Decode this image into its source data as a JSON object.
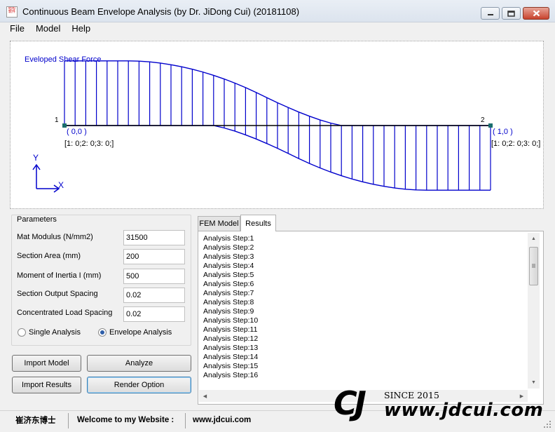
{
  "window": {
    "title": "Continuous Beam Envelope Analysis (by Dr. JiDong Cui) (20181108)",
    "icon_text": "结构 软件",
    "controls": {
      "minimize": "—",
      "maximize": "▭",
      "close": "✕"
    }
  },
  "menu": [
    {
      "label": "File"
    },
    {
      "label": "Model"
    },
    {
      "label": "Help"
    }
  ],
  "diagram": {
    "caption": "Eveloped Shear Force",
    "node1": {
      "id": "1",
      "coord": "( 0,0 )",
      "restraint": "[1: 0;2: 0;3: 0;]"
    },
    "node2": {
      "id": "2",
      "coord": "( 1,0 )",
      "restraint": "[1: 0;2: 0;3: 0;]"
    },
    "axis_y": "Y",
    "axis_x": "X",
    "line_color": "#0000cc",
    "node_color": "#1a6e6e",
    "upper_envelope": [
      95,
      95,
      95,
      95,
      95,
      95,
      95,
      94.7,
      93.6,
      91.8,
      89.4,
      86.4,
      82.8,
      78.6,
      73.8,
      68.4,
      62.4,
      55.8,
      48.6,
      41,
      33.5,
      26.5,
      19.8,
      13.7,
      8.2,
      3.6,
      0,
      0,
      0,
      0,
      0,
      0,
      0,
      0,
      0,
      0,
      0,
      0,
      0,
      0,
      0
    ],
    "lower_envelope": [
      0,
      0,
      0,
      0,
      0,
      0,
      0,
      0,
      0,
      0,
      0,
      0,
      0,
      0,
      0,
      -3.6,
      -8.2,
      -13.7,
      -19.8,
      -26.5,
      -33.5,
      -41,
      -48.6,
      -55.8,
      -62.4,
      -68.4,
      -73.8,
      -78.6,
      -82.8,
      -86.4,
      -89.4,
      -91.8,
      -93.6,
      -94.7,
      -95,
      -95,
      -95,
      -95,
      -95,
      -95,
      -95
    ]
  },
  "parameters": {
    "title": "Parameters",
    "fields": [
      {
        "label": "Mat Modulus (N/mm2)",
        "value": "31500"
      },
      {
        "label": "Section Area  (mm)",
        "value": "200"
      },
      {
        "label": "Moment of Inertia I (mm)",
        "value": "500"
      },
      {
        "label": "Section Output Spacing",
        "value": "0.02"
      },
      {
        "label": "Concentrated Load Spacing",
        "value": "0.02"
      }
    ],
    "radio_single": "Single Analysis",
    "radio_envelope": "Envelope Analysis",
    "selected": "Envelope Analysis"
  },
  "buttons": {
    "import_model": "Import Model",
    "analyze": "Analyze",
    "import_results": "Import Results",
    "render_option": "Render Option"
  },
  "tabs": [
    {
      "label": "FEM Model",
      "active": false
    },
    {
      "label": "Results",
      "active": true
    }
  ],
  "results": [
    "Analysis Step:1",
    "Analysis Step:2",
    "Analysis Step:3",
    "Analysis Step:4",
    "Analysis Step:5",
    "Analysis Step:6",
    "Analysis Step:7",
    "Analysis Step:8",
    "Analysis Step:9",
    "Analysis Step:10",
    "Analysis Step:11",
    "Analysis Step:12",
    "Analysis Step:13",
    "Analysis Step:14",
    "Analysis Step:15",
    "Analysis Step:16"
  ],
  "statusbar": {
    "author": "崔济东博士",
    "welcome": "Welcome to my Website :",
    "website": "www.jdcui.com"
  },
  "logo": {
    "mark": "CJ",
    "since": "SINCE 2015",
    "url": "www.jdcui.com"
  }
}
